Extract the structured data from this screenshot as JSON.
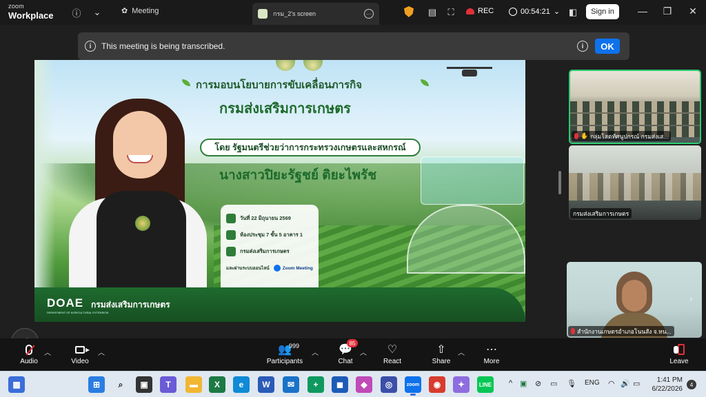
{
  "app": {
    "brand_line1": "zoom",
    "brand_line2": "Workplace"
  },
  "titlebar": {
    "meeting_label": "Meeting",
    "tab_label": "กรม_2's screen",
    "rec_label": "REC",
    "timer": "00:54:21",
    "signin_label": "Sign in"
  },
  "banner": {
    "text": "This meeting is being transcribed.",
    "ok_label": "OK"
  },
  "slide": {
    "title1": "การมอบนโยบายการขับเคลื่อนภารกิจ",
    "title2": "กรมส่งเสริมการเกษตร",
    "by_line": "โดย  รัฐมนตรีช่วยว่าการกระทรวงเกษตรและสหกรณ์",
    "name": "นางสาวปิยะรัฐชย์  ติยะไพรัช",
    "info": {
      "date": "วันที่ 22 มิถุนายน 2569",
      "room": "ห้องประชุม 7 ชั้น 5 อาคาร 1",
      "org": "กรมส่งเสริมการเกษตร",
      "online_prefix": "และผ่านระบบออนไลน์",
      "online_tool": "Zoom Meeting"
    },
    "footer_logo": "DOAE",
    "footer_logo_sub": "DEPARTMENT OF AGRICULTURAL EXTENSION",
    "footer_org": "กรมส่งเสริมการเกษตร"
  },
  "participants_tiles": [
    {
      "name": "กลุ่มโสตทัศนูปกรณ์ กรมส่งเส..."
    },
    {
      "name": "กรมส่งเสริมการเกษตร"
    },
    {
      "name": "สำนักงานเกษตรอำเภอโนนสัง จ.หน..."
    }
  ],
  "toolbar": {
    "audio": "Audio",
    "video": "Video",
    "participants": "Participants",
    "participants_count": "999",
    "chat": "Chat",
    "chat_badge": "85",
    "react": "React",
    "share": "Share",
    "more": "More",
    "leave": "Leave"
  },
  "taskbar": {
    "lang": "ENG",
    "time": "1:41 PM",
    "date": "6/22/2026",
    "notifications": "4"
  },
  "colors": {
    "accent": "#0e72ed",
    "active_speaker": "#2ecc71",
    "recording": "#e0303a",
    "slide_green": "#1d6a2c"
  }
}
